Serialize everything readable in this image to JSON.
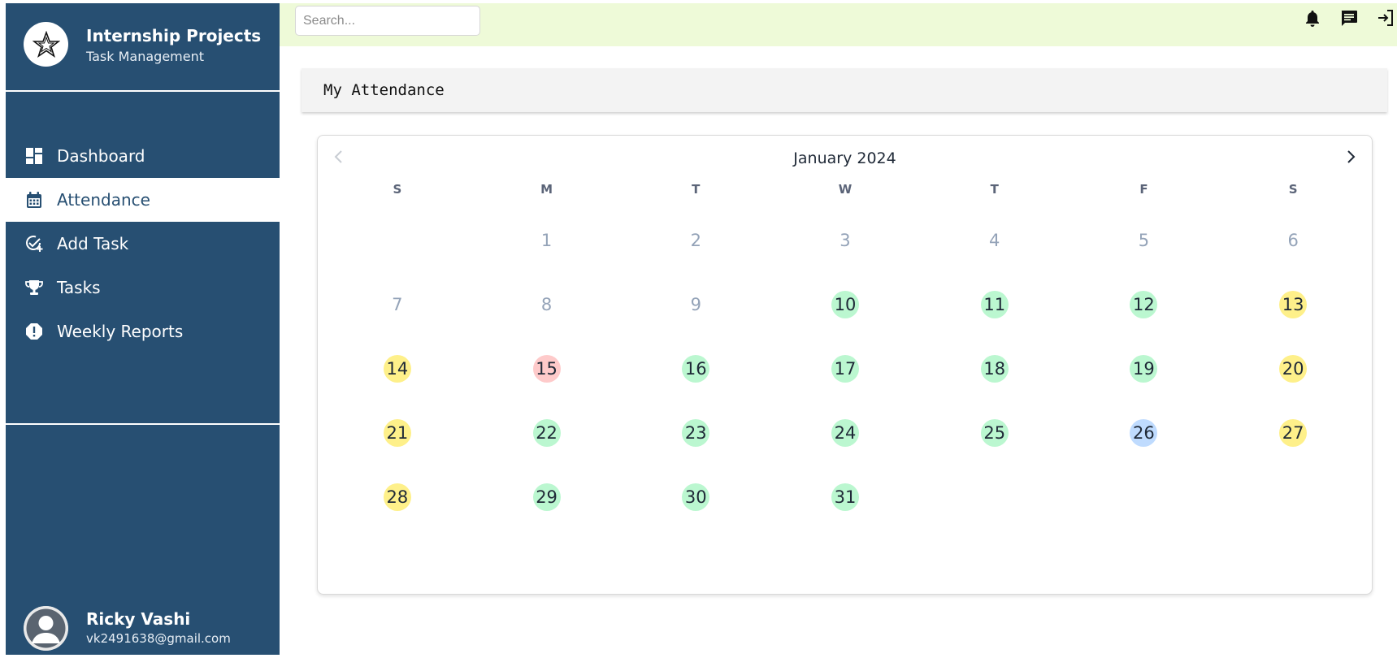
{
  "app": {
    "title": "Internship Projects",
    "subtitle": "Task Management"
  },
  "sidebar": {
    "items": [
      {
        "label": "Dashboard",
        "icon": "dashboard-icon",
        "active": false
      },
      {
        "label": "Attendance",
        "icon": "calendar-icon",
        "active": true
      },
      {
        "label": "Add Task",
        "icon": "add-task-icon",
        "active": false
      },
      {
        "label": "Tasks",
        "icon": "trophy-icon",
        "active": false
      },
      {
        "label": "Weekly Reports",
        "icon": "report-icon",
        "active": false
      }
    ]
  },
  "user": {
    "name": "Ricky Vashi",
    "email": "vk2491638@gmail.com"
  },
  "topbar": {
    "search_placeholder": "Search...",
    "icons": [
      "bell-icon",
      "message-icon",
      "logout-icon"
    ]
  },
  "page": {
    "title": "My Attendance"
  },
  "calendar": {
    "month_label": "January 2024",
    "weekdays": [
      "S",
      "M",
      "T",
      "W",
      "T",
      "F",
      "S"
    ],
    "leading_blanks": 1,
    "days": [
      {
        "day": "1",
        "status": "none"
      },
      {
        "day": "2",
        "status": "none"
      },
      {
        "day": "3",
        "status": "none"
      },
      {
        "day": "4",
        "status": "none"
      },
      {
        "day": "5",
        "status": "none"
      },
      {
        "day": "6",
        "status": "none"
      },
      {
        "day": "7",
        "status": "none"
      },
      {
        "day": "8",
        "status": "none"
      },
      {
        "day": "9",
        "status": "none"
      },
      {
        "day": "10",
        "status": "present"
      },
      {
        "day": "11",
        "status": "present"
      },
      {
        "day": "12",
        "status": "present"
      },
      {
        "day": "13",
        "status": "weekend"
      },
      {
        "day": "14",
        "status": "weekend"
      },
      {
        "day": "15",
        "status": "absent"
      },
      {
        "day": "16",
        "status": "present"
      },
      {
        "day": "17",
        "status": "present"
      },
      {
        "day": "18",
        "status": "present"
      },
      {
        "day": "19",
        "status": "present"
      },
      {
        "day": "20",
        "status": "weekend"
      },
      {
        "day": "21",
        "status": "weekend"
      },
      {
        "day": "22",
        "status": "present"
      },
      {
        "day": "23",
        "status": "present"
      },
      {
        "day": "24",
        "status": "present"
      },
      {
        "day": "25",
        "status": "present"
      },
      {
        "day": "26",
        "status": "holiday"
      },
      {
        "day": "27",
        "status": "weekend"
      },
      {
        "day": "28",
        "status": "weekend"
      },
      {
        "day": "29",
        "status": "present"
      },
      {
        "day": "30",
        "status": "present"
      },
      {
        "day": "31",
        "status": "present"
      }
    ]
  },
  "colors": {
    "sidebar_bg": "#274f72",
    "topbar_bg": "#eefad8",
    "present": "#bbf7d0",
    "weekend": "#fef08a",
    "absent": "#fecaca",
    "holiday": "#bfdbfe"
  }
}
